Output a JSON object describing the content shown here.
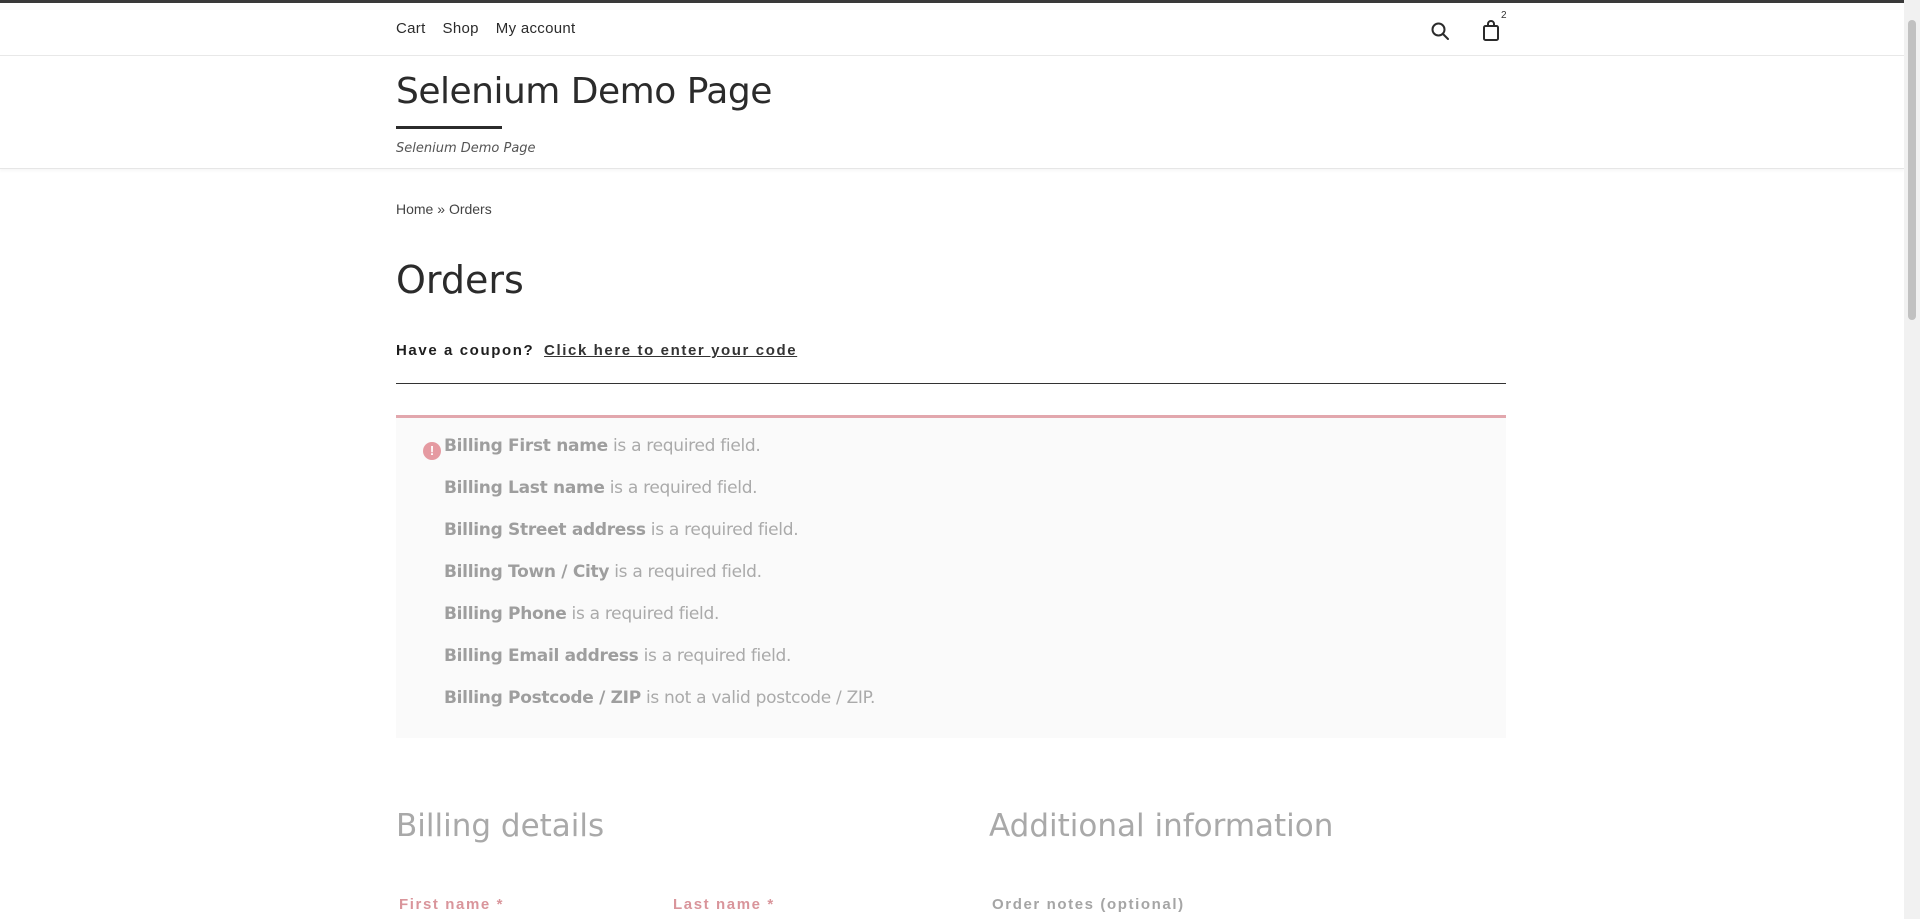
{
  "nav": {
    "items": [
      {
        "label": "Cart"
      },
      {
        "label": "Shop"
      },
      {
        "label": "My account"
      }
    ],
    "cart_count": "2"
  },
  "header": {
    "site_title": "Selenium Demo Page",
    "tagline": "Selenium Demo Page"
  },
  "breadcrumb": {
    "home": "Home",
    "separator": " » ",
    "current": "Orders"
  },
  "page": {
    "title": "Orders"
  },
  "coupon": {
    "prompt": "Have a coupon?",
    "link": "Click here to enter your code"
  },
  "errors": [
    {
      "field": "Billing First name",
      "message": " is a required field."
    },
    {
      "field": "Billing Last name",
      "message": " is a required field."
    },
    {
      "field": "Billing Street address",
      "message": " is a required field."
    },
    {
      "field": "Billing Town / City",
      "message": " is a required field."
    },
    {
      "field": "Billing Phone",
      "message": " is a required field."
    },
    {
      "field": "Billing Email address",
      "message": " is a required field."
    },
    {
      "field": "Billing Postcode / ZIP",
      "message": " is not a valid postcode / ZIP."
    }
  ],
  "billing": {
    "title": "Billing details",
    "first_name_label": "First name *",
    "last_name_label": "Last name *"
  },
  "additional": {
    "title": "Additional information",
    "order_notes_label": "Order notes (optional)"
  },
  "colors": {
    "error_accent": "#e2a7ad",
    "required_label": "#d9959b",
    "muted_text": "#aaaaaa"
  },
  "icons": {
    "search": "search-icon",
    "cart": "shopping-bag-icon",
    "error": "exclamation-circle-icon"
  }
}
